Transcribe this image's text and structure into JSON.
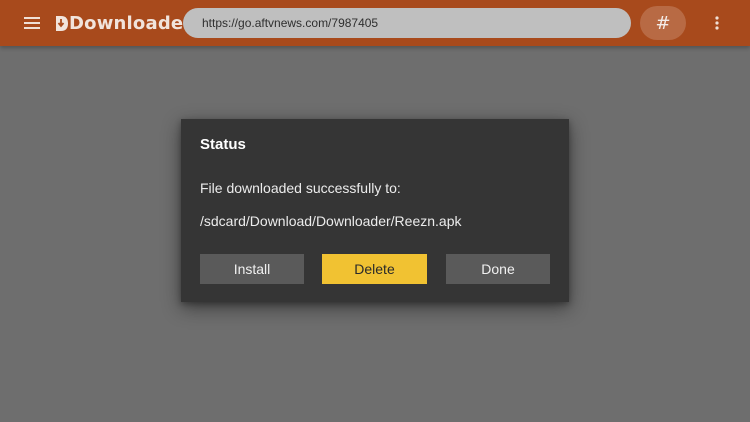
{
  "app": {
    "name": "Downloader",
    "accent_color": "#a84a1c",
    "menu_icon": "hamburger-menu-icon",
    "more_icon": "vertical-dots-icon"
  },
  "toolbar": {
    "url_value": "https://go.aftvnews.com/7987405",
    "hash_label": "#"
  },
  "dialog": {
    "title": "Status",
    "message": "File downloaded successfully to:",
    "file_path": "/sdcard/Download/Downloader/Reezn.apk",
    "buttons": {
      "install": "Install",
      "delete": "Delete",
      "done": "Done"
    },
    "focused_button_color": "#f1c232"
  }
}
